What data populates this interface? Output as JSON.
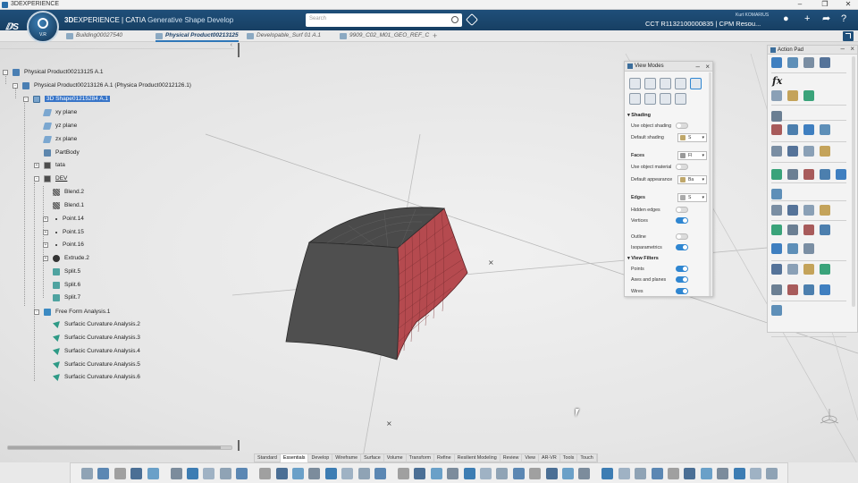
{
  "window": {
    "title": "3DEXPERIENCE"
  },
  "app": {
    "brand_bold": "3D",
    "brand_main": "EXPERIENCE | CATIA",
    "brand_app": "Generative Shape Develop",
    "compass_version": "V.R",
    "search_placeholder": "Search",
    "identity": "CCT R1132100000835 | CPM Resou...",
    "user_name": "Kurt KOMARIUS"
  },
  "tabs": [
    {
      "label": "Building00027540",
      "active": false
    },
    {
      "label": "Physical Product00213125",
      "active": true
    },
    {
      "label": "Developable_Surf 01 A.1",
      "active": false
    },
    {
      "label": "9909_C02_M01_GEO_REF_C",
      "active": false
    }
  ],
  "tab_add": "+",
  "tree": [
    {
      "label": "Physical Product00213125 A.1",
      "icon": "prod",
      "level": 0
    },
    {
      "label": "Physical Product00213126 A.1 (Physica Product00212126.1)",
      "icon": "prod",
      "level": 1
    },
    {
      "label": "3D Shape01215284 A.1",
      "icon": "shape",
      "level": 2,
      "selected": true
    },
    {
      "label": "xy plane",
      "icon": "plane",
      "level": 3
    },
    {
      "label": "yz plane",
      "icon": "plane",
      "level": 3
    },
    {
      "label": "zx plane",
      "icon": "plane",
      "level": 3
    },
    {
      "label": "PartBody",
      "icon": "body",
      "level": 3
    },
    {
      "label": "tata",
      "icon": "set",
      "level": 3
    },
    {
      "label": "DEV",
      "icon": "set",
      "level": 3,
      "underline": true
    },
    {
      "label": "Blend.2",
      "icon": "feat",
      "level": 4
    },
    {
      "label": "Blend.1",
      "icon": "feat",
      "level": 4
    },
    {
      "label": "Point.14",
      "icon": "pt",
      "level": 4
    },
    {
      "label": "Point.15",
      "icon": "pt",
      "level": 4
    },
    {
      "label": "Point.16",
      "icon": "pt",
      "level": 4
    },
    {
      "label": "Extrude.2",
      "icon": "extr",
      "level": 4
    },
    {
      "label": "Split.5",
      "icon": "split",
      "level": 4
    },
    {
      "label": "Split.6",
      "icon": "split",
      "level": 4
    },
    {
      "label": "Split.7",
      "icon": "split",
      "level": 4
    },
    {
      "label": "Free Form Analysis.1",
      "icon": "ffa",
      "level": 3
    },
    {
      "label": "Surfacic Curvature Analysis.2",
      "icon": "analysis",
      "level": 4
    },
    {
      "label": "Surfacic Curvature Analysis.3",
      "icon": "analysis",
      "level": 4
    },
    {
      "label": "Surfacic Curvature Analysis.4",
      "icon": "analysis",
      "level": 4
    },
    {
      "label": "Surfacic Curvature Analysis.5",
      "icon": "analysis",
      "level": 4
    },
    {
      "label": "Surfacic Curvature Analysis.6",
      "icon": "analysis",
      "level": 4
    }
  ],
  "view_modes": {
    "title": "View Modes",
    "shading_header": "Shading",
    "use_object_shading": {
      "label": "Use object shading",
      "on": false
    },
    "default_shading": {
      "label": "Default shading",
      "value": "S"
    },
    "faces_header": "Faces",
    "faces_value": "FI",
    "use_object_material": {
      "label": "Use object material",
      "on": false
    },
    "default_appearance": {
      "label": "Default appearance",
      "value": "Ba"
    },
    "edges_header": "Edges",
    "edges_value": "S",
    "hidden_edges": {
      "label": "Hidden edges",
      "on": false
    },
    "vertices": {
      "label": "Vertices",
      "on": true
    },
    "outline": {
      "label": "Outline",
      "on": false
    },
    "isoparametrics": {
      "label": "Isoparametrics",
      "on": true
    },
    "view_filters_header": "View Filters",
    "points": {
      "label": "Points",
      "on": true
    },
    "axes_and_planes": {
      "label": "Axes and planes",
      "on": true
    },
    "wires": {
      "label": "Wires",
      "on": true
    }
  },
  "action_pad": {
    "title": "Action Pad",
    "formula_glyph": "fx"
  },
  "bottom_tabs": [
    "Standard",
    "Essentials",
    "Develop",
    "Wireframe",
    "Surface",
    "Volume",
    "Transform",
    "Refine",
    "Resilient Modeling",
    "Review",
    "View",
    "AR-VR",
    "Tools",
    "Touch"
  ],
  "bottom_tab_active": "Essentials",
  "colors": {
    "accent": "#2f86d1",
    "appbar": "#1f4f7a",
    "surface_dark": "#4a4a4a",
    "surface_red": "#b54a4f"
  }
}
